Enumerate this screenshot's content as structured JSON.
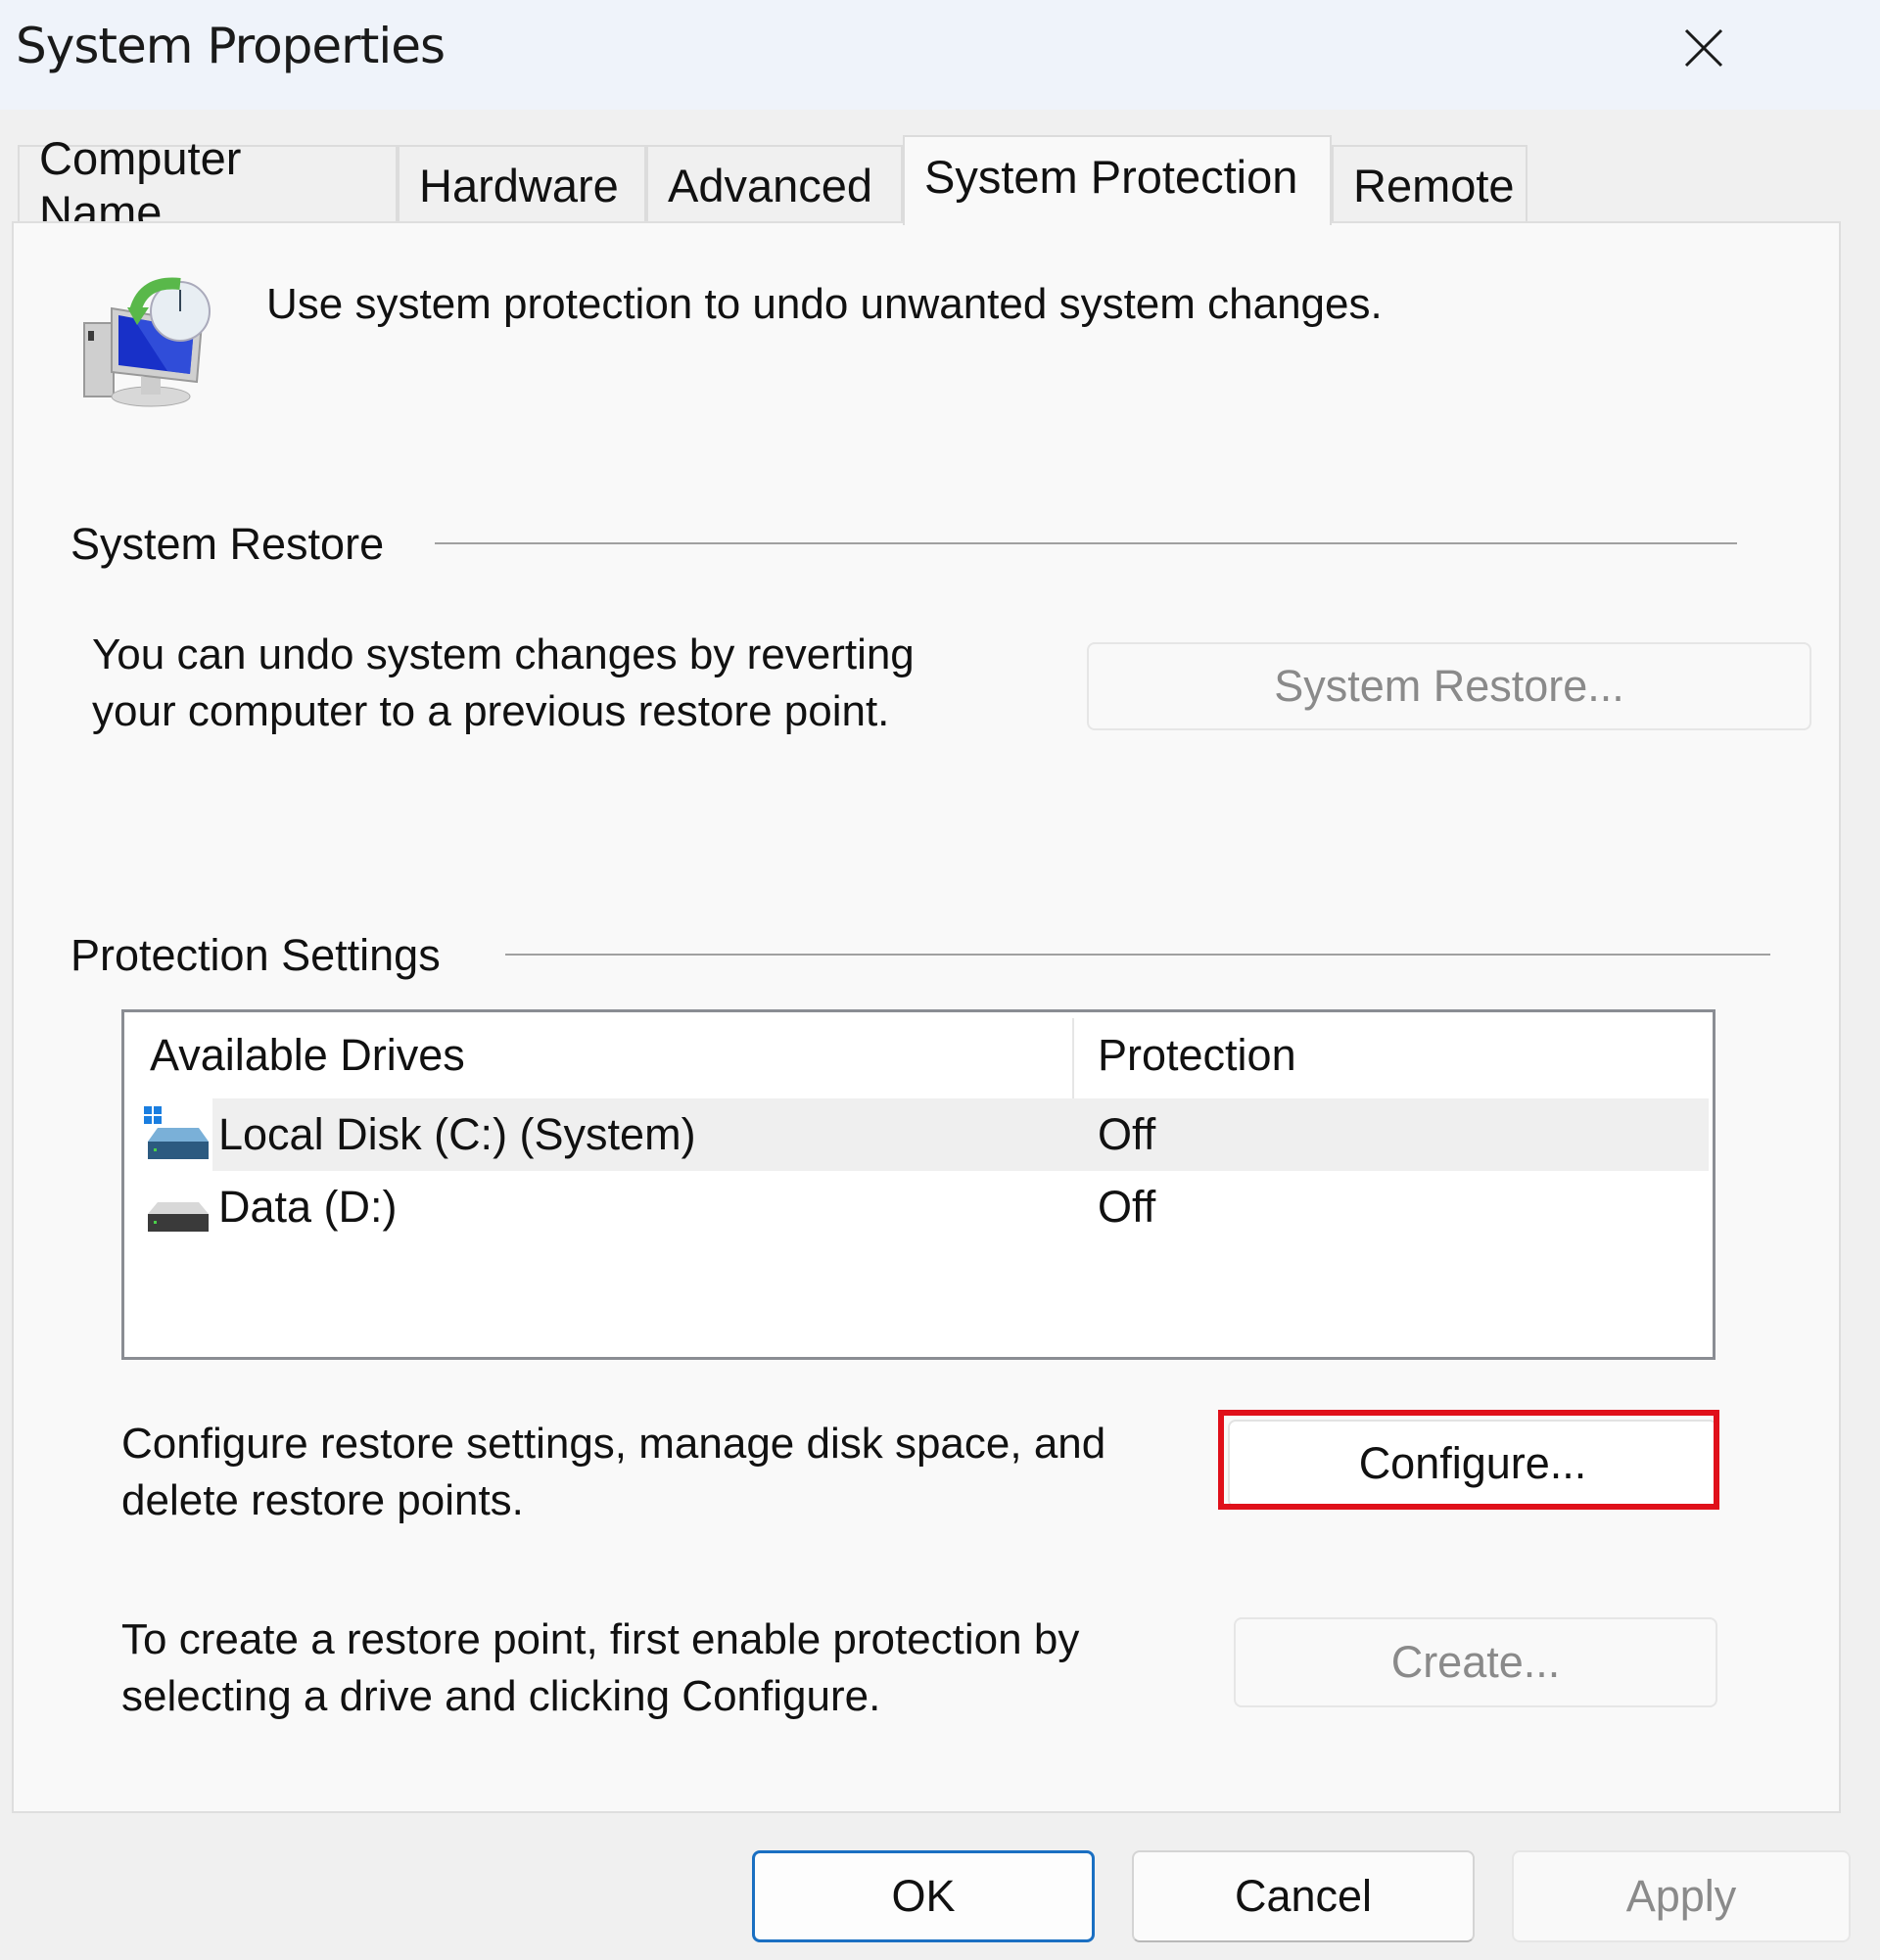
{
  "window": {
    "title": "System Properties",
    "close_icon": "close-icon"
  },
  "tabs": [
    {
      "label": "Computer Name",
      "active": false
    },
    {
      "label": "Hardware",
      "active": false
    },
    {
      "label": "Advanced",
      "active": false
    },
    {
      "label": "System Protection",
      "active": true
    },
    {
      "label": "Remote",
      "active": false
    }
  ],
  "panel": {
    "header_icon": "system-restore-icon",
    "intro_text": "Use system protection to undo unwanted system changes.",
    "system_restore": {
      "group_title": "System Restore",
      "description_line1": "You can undo system changes by reverting",
      "description_line2": "your computer to a previous restore point.",
      "button_label": "System Restore...",
      "button_enabled": false
    },
    "protection_settings": {
      "group_title": "Protection Settings",
      "columns": [
        "Available Drives",
        "Protection"
      ],
      "drives": [
        {
          "name": "Local Disk (C:) (System)",
          "protection": "Off",
          "icon": "system-drive-icon",
          "selected": true
        },
        {
          "name": "Data (D:)",
          "protection": "Off",
          "icon": "drive-icon",
          "selected": false
        }
      ],
      "configure_text_line1": "Configure restore settings, manage disk space, and",
      "configure_text_line2": "delete restore points.",
      "configure_button_label": "Configure...",
      "configure_highlighted": true,
      "create_text_line1": "To create a restore point, first enable protection by",
      "create_text_line2": "selecting a drive and clicking Configure.",
      "create_button_label": "Create...",
      "create_button_enabled": false
    }
  },
  "footer": {
    "ok_label": "OK",
    "cancel_label": "Cancel",
    "apply_label": "Apply",
    "apply_enabled": false
  },
  "colors": {
    "highlight": "#e0101a",
    "primary_border": "#1a6fc2",
    "titlebar_bg": "#eff3fa"
  }
}
